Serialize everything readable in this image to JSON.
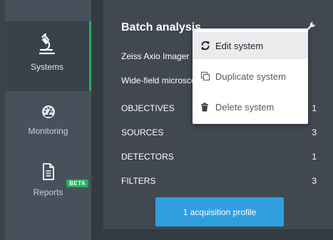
{
  "sidebar": {
    "items": [
      {
        "label": "Systems",
        "icon": "microscope-icon",
        "active": true
      },
      {
        "label": "Monitoring",
        "icon": "speedometer-icon",
        "active": false
      },
      {
        "label": "Reports",
        "icon": "document-icon",
        "active": false,
        "badge": "BETA"
      }
    ]
  },
  "panel": {
    "title": "Batch analysis",
    "subtitle_1": "Zeiss Axio Imager",
    "subtitle_2": "Wide-field microscope",
    "rows": [
      {
        "label": "OBJECTIVES",
        "count": "1"
      },
      {
        "label": "SOURCES",
        "count": "3"
      },
      {
        "label": "DETECTORS",
        "count": "1"
      },
      {
        "label": "FILTERS",
        "count": "3"
      }
    ],
    "acquisition_button": "1 acquisition profile"
  },
  "menu": {
    "items": [
      {
        "label": "Edit system",
        "icon": "refresh-icon",
        "highlighted": true
      },
      {
        "label": "Duplicate system",
        "icon": "copy-icon",
        "highlighted": false
      },
      {
        "label": "Delete system",
        "icon": "trash-icon",
        "highlighted": false
      }
    ]
  },
  "colors": {
    "accent_green": "#27ae60",
    "button_blue": "#2f9fe0",
    "sidebar_bg": "#48515b",
    "panel_bg": "#414850"
  }
}
